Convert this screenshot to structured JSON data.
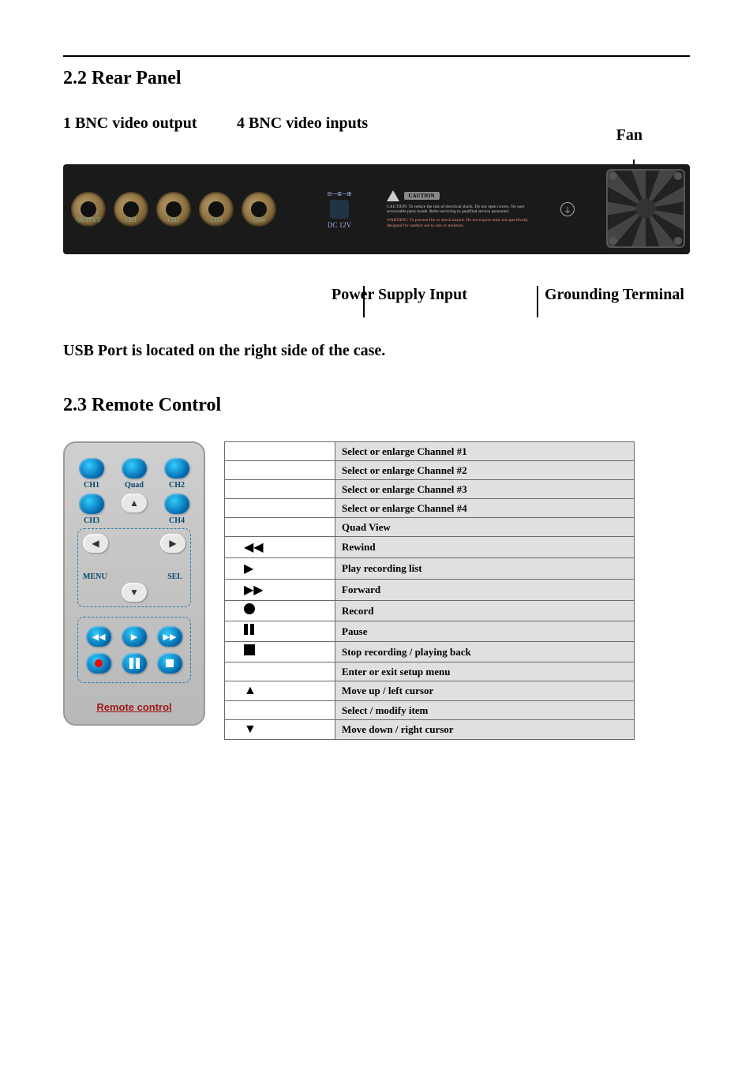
{
  "sections": {
    "rear_title": "2.2 Rear Panel",
    "remote_title": "2.3 Remote Control"
  },
  "rear": {
    "label_video_out": "1 BNC video output",
    "label_video_in": "4 BNC video inputs",
    "label_fan": "Fan",
    "label_power": "Power Supply Input",
    "label_ground": "Grounding Terminal",
    "port_labels": {
      "out": "VIDEO OUTPUT",
      "ch1": "CH1",
      "ch2": "CH2",
      "ch3": "CH3",
      "ch4": "CH4"
    },
    "dc_label": "DC 12V",
    "caution_badge": "CAUTION",
    "caution_text": "CAUTION: To reduce the risk of electrical shock. Do not open covers. No user serviceable parts inside. Refer servicing to qualified service personnel.",
    "warning_text": "WARNING: To prevent fire or shock hazard. Do not expose units not specifically designed for outdoor use to rain or moisture."
  },
  "usb_note": "USB Port is located on the right side of the case.",
  "remote": {
    "btn_ch1": "CH1",
    "btn_quad": "Quad",
    "btn_ch2": "CH2",
    "btn_ch3": "CH3",
    "btn_ch4": "CH4",
    "btn_menu": "MENU",
    "btn_sel": "SEL",
    "footer": "Remote control"
  },
  "table_rows": [
    {
      "icon": "",
      "desc": "Select or enlarge Channel #1"
    },
    {
      "icon": "",
      "desc": "Select or enlarge Channel #2"
    },
    {
      "icon": "",
      "desc": "Select or enlarge Channel #3"
    },
    {
      "icon": "",
      "desc": "Select or enlarge Channel #4"
    },
    {
      "icon": "",
      "desc": "Quad View"
    },
    {
      "icon": "rewind",
      "desc": "Rewind"
    },
    {
      "icon": "play",
      "desc": "Play recording list"
    },
    {
      "icon": "forward",
      "desc": "Forward"
    },
    {
      "icon": "record",
      "desc": "Record"
    },
    {
      "icon": "pause",
      "desc": "Pause"
    },
    {
      "icon": "stop",
      "desc": "Stop recording / playing back"
    },
    {
      "icon": "",
      "desc": "Enter or exit setup menu"
    },
    {
      "icon": "up",
      "desc": "Move up / left cursor"
    },
    {
      "icon": "",
      "desc": "Select / modify item"
    },
    {
      "icon": "down",
      "desc": "Move down / right cursor"
    }
  ]
}
